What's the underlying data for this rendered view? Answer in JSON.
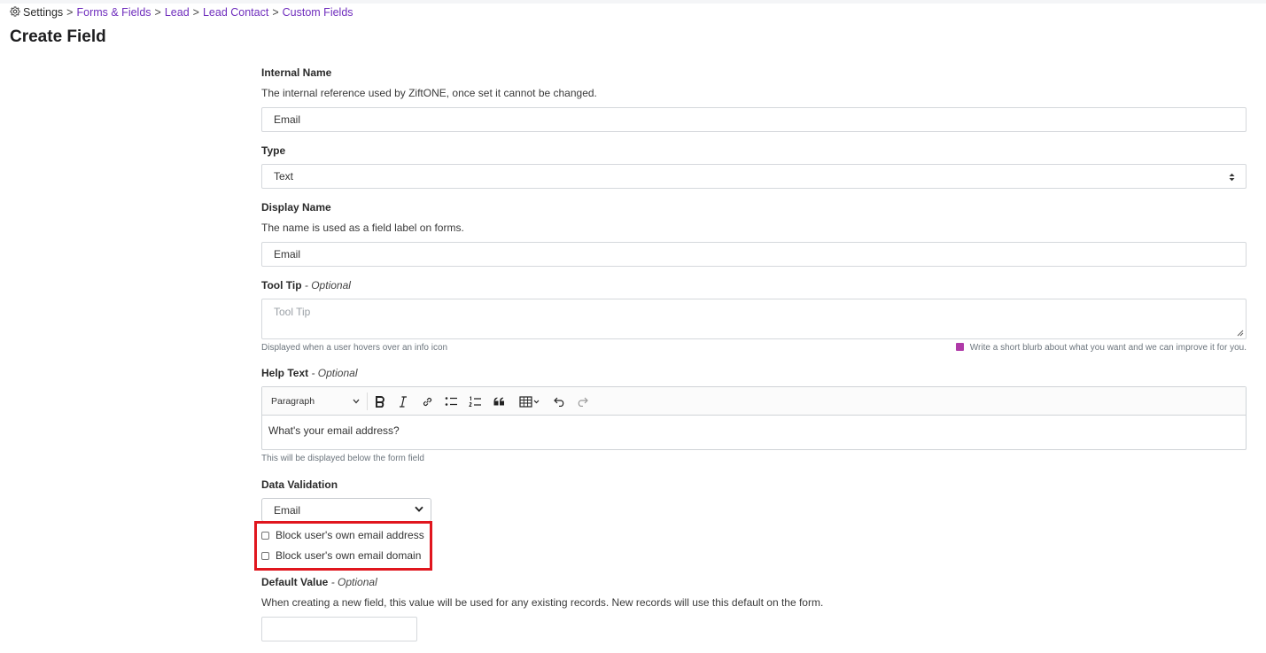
{
  "breadcrumb": {
    "settings": "Settings",
    "separator": ">",
    "forms_fields": "Forms & Fields",
    "lead": "Lead",
    "lead_contact": "Lead Contact",
    "custom_fields": "Custom Fields"
  },
  "page": {
    "title": "Create Field"
  },
  "internal_name": {
    "label": "Internal Name",
    "description": "The internal reference used by ZiftONE, once set it cannot be changed.",
    "value": "Email"
  },
  "type": {
    "label": "Type",
    "value": "Text"
  },
  "display_name": {
    "label": "Display Name",
    "description": "The name is used as a field label on forms.",
    "value": "Email"
  },
  "tool_tip": {
    "label": "Tool Tip",
    "optional": "- Optional",
    "placeholder": "Tool Tip",
    "hint": "Displayed when a user hovers over an info icon",
    "ai_hint": "Write a short blurb about what you want and we can improve it for you."
  },
  "help_text": {
    "label": "Help Text",
    "optional": "- Optional",
    "paragraph_style": "Paragraph",
    "content": "What's your email address?",
    "hint": "This will be displayed below the form field"
  },
  "data_validation": {
    "label": "Data Validation",
    "value": "Email",
    "options": [
      {
        "label": "Block user's own email address",
        "checked": false
      },
      {
        "label": "Block user's own email domain",
        "checked": false
      }
    ]
  },
  "default_value": {
    "label": "Default Value",
    "optional": "- Optional",
    "description": "When creating a new field, this value will be used for any existing records. New records will use this default on the form.",
    "value": ""
  },
  "colors": {
    "link": "#6f2dbd",
    "highlight": "#e0161e",
    "ai_badge": "#b03aa8"
  },
  "icons": {
    "settings": "gear-icon",
    "select": "up-down-arrows-icon",
    "dropdown": "chevron-down-icon",
    "ai": "ai-sparkle-icon",
    "toolbar": [
      "bold-icon",
      "italic-icon",
      "link-icon",
      "bulleted-list-icon",
      "numbered-list-icon",
      "blockquote-icon",
      "table-icon",
      "undo-icon",
      "redo-icon"
    ]
  }
}
